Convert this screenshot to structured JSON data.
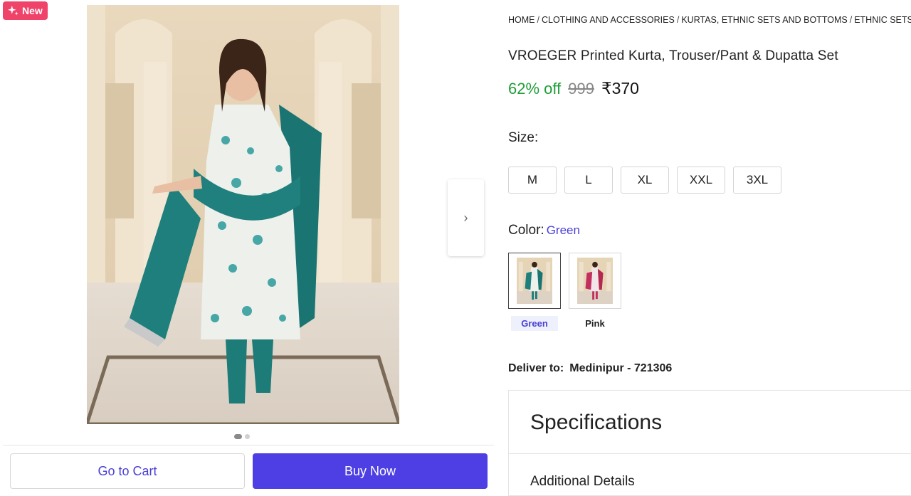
{
  "gallery": {
    "badge": "New",
    "next_icon": "chevron-right-icon",
    "next_glyph": "›"
  },
  "actions": {
    "cart_label": "Go to Cart",
    "buy_label": "Buy Now",
    "buy_color": "#4d3fe3"
  },
  "breadcrumb": [
    "HOME",
    "CLOTHING AND ACCESSORIES",
    "KURTAS, ETHNIC SETS AND BOTTOMS",
    "ETHNIC SETS"
  ],
  "product": {
    "title": "VROEGER Printed Kurta, Trouser/Pant & Dupatta Set",
    "discount": "62% off",
    "mrp": "999",
    "price": "₹370"
  },
  "size": {
    "label": "Size:",
    "options": [
      "M",
      "L",
      "XL",
      "XXL",
      "3XL"
    ]
  },
  "color": {
    "label": "Color:",
    "selected": "Green",
    "options": [
      "Green",
      "Pink"
    ]
  },
  "delivery": {
    "label": "Deliver to:",
    "location": "Medinipur - 721306"
  },
  "specs": {
    "title": "Specifications",
    "section": "Additional Details"
  }
}
